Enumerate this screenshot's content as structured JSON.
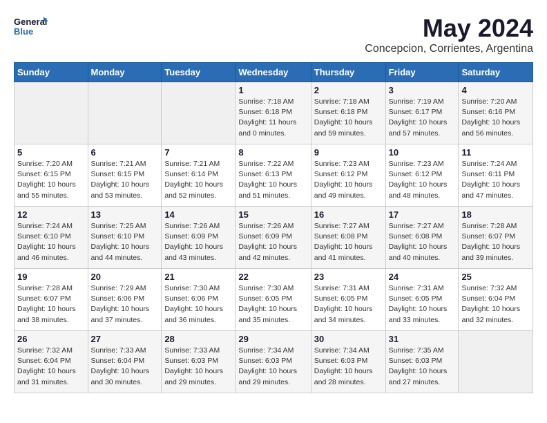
{
  "header": {
    "logo_line1": "General",
    "logo_line2": "Blue",
    "title": "May 2024",
    "subtitle": "Concepcion, Corrientes, Argentina"
  },
  "calendar": {
    "days_of_week": [
      "Sunday",
      "Monday",
      "Tuesday",
      "Wednesday",
      "Thursday",
      "Friday",
      "Saturday"
    ],
    "weeks": [
      [
        {
          "day": "",
          "info": ""
        },
        {
          "day": "",
          "info": ""
        },
        {
          "day": "",
          "info": ""
        },
        {
          "day": "1",
          "info": "Sunrise: 7:18 AM\nSunset: 6:18 PM\nDaylight: 11 hours\nand 0 minutes."
        },
        {
          "day": "2",
          "info": "Sunrise: 7:18 AM\nSunset: 6:18 PM\nDaylight: 10 hours\nand 59 minutes."
        },
        {
          "day": "3",
          "info": "Sunrise: 7:19 AM\nSunset: 6:17 PM\nDaylight: 10 hours\nand 57 minutes."
        },
        {
          "day": "4",
          "info": "Sunrise: 7:20 AM\nSunset: 6:16 PM\nDaylight: 10 hours\nand 56 minutes."
        }
      ],
      [
        {
          "day": "5",
          "info": "Sunrise: 7:20 AM\nSunset: 6:15 PM\nDaylight: 10 hours\nand 55 minutes."
        },
        {
          "day": "6",
          "info": "Sunrise: 7:21 AM\nSunset: 6:15 PM\nDaylight: 10 hours\nand 53 minutes."
        },
        {
          "day": "7",
          "info": "Sunrise: 7:21 AM\nSunset: 6:14 PM\nDaylight: 10 hours\nand 52 minutes."
        },
        {
          "day": "8",
          "info": "Sunrise: 7:22 AM\nSunset: 6:13 PM\nDaylight: 10 hours\nand 51 minutes."
        },
        {
          "day": "9",
          "info": "Sunrise: 7:23 AM\nSunset: 6:12 PM\nDaylight: 10 hours\nand 49 minutes."
        },
        {
          "day": "10",
          "info": "Sunrise: 7:23 AM\nSunset: 6:12 PM\nDaylight: 10 hours\nand 48 minutes."
        },
        {
          "day": "11",
          "info": "Sunrise: 7:24 AM\nSunset: 6:11 PM\nDaylight: 10 hours\nand 47 minutes."
        }
      ],
      [
        {
          "day": "12",
          "info": "Sunrise: 7:24 AM\nSunset: 6:10 PM\nDaylight: 10 hours\nand 46 minutes."
        },
        {
          "day": "13",
          "info": "Sunrise: 7:25 AM\nSunset: 6:10 PM\nDaylight: 10 hours\nand 44 minutes."
        },
        {
          "day": "14",
          "info": "Sunrise: 7:26 AM\nSunset: 6:09 PM\nDaylight: 10 hours\nand 43 minutes."
        },
        {
          "day": "15",
          "info": "Sunrise: 7:26 AM\nSunset: 6:09 PM\nDaylight: 10 hours\nand 42 minutes."
        },
        {
          "day": "16",
          "info": "Sunrise: 7:27 AM\nSunset: 6:08 PM\nDaylight: 10 hours\nand 41 minutes."
        },
        {
          "day": "17",
          "info": "Sunrise: 7:27 AM\nSunset: 6:08 PM\nDaylight: 10 hours\nand 40 minutes."
        },
        {
          "day": "18",
          "info": "Sunrise: 7:28 AM\nSunset: 6:07 PM\nDaylight: 10 hours\nand 39 minutes."
        }
      ],
      [
        {
          "day": "19",
          "info": "Sunrise: 7:28 AM\nSunset: 6:07 PM\nDaylight: 10 hours\nand 38 minutes."
        },
        {
          "day": "20",
          "info": "Sunrise: 7:29 AM\nSunset: 6:06 PM\nDaylight: 10 hours\nand 37 minutes."
        },
        {
          "day": "21",
          "info": "Sunrise: 7:30 AM\nSunset: 6:06 PM\nDaylight: 10 hours\nand 36 minutes."
        },
        {
          "day": "22",
          "info": "Sunrise: 7:30 AM\nSunset: 6:05 PM\nDaylight: 10 hours\nand 35 minutes."
        },
        {
          "day": "23",
          "info": "Sunrise: 7:31 AM\nSunset: 6:05 PM\nDaylight: 10 hours\nand 34 minutes."
        },
        {
          "day": "24",
          "info": "Sunrise: 7:31 AM\nSunset: 6:05 PM\nDaylight: 10 hours\nand 33 minutes."
        },
        {
          "day": "25",
          "info": "Sunrise: 7:32 AM\nSunset: 6:04 PM\nDaylight: 10 hours\nand 32 minutes."
        }
      ],
      [
        {
          "day": "26",
          "info": "Sunrise: 7:32 AM\nSunset: 6:04 PM\nDaylight: 10 hours\nand 31 minutes."
        },
        {
          "day": "27",
          "info": "Sunrise: 7:33 AM\nSunset: 6:04 PM\nDaylight: 10 hours\nand 30 minutes."
        },
        {
          "day": "28",
          "info": "Sunrise: 7:33 AM\nSunset: 6:03 PM\nDaylight: 10 hours\nand 29 minutes."
        },
        {
          "day": "29",
          "info": "Sunrise: 7:34 AM\nSunset: 6:03 PM\nDaylight: 10 hours\nand 29 minutes."
        },
        {
          "day": "30",
          "info": "Sunrise: 7:34 AM\nSunset: 6:03 PM\nDaylight: 10 hours\nand 28 minutes."
        },
        {
          "day": "31",
          "info": "Sunrise: 7:35 AM\nSunset: 6:03 PM\nDaylight: 10 hours\nand 27 minutes."
        },
        {
          "day": "",
          "info": ""
        }
      ]
    ]
  }
}
